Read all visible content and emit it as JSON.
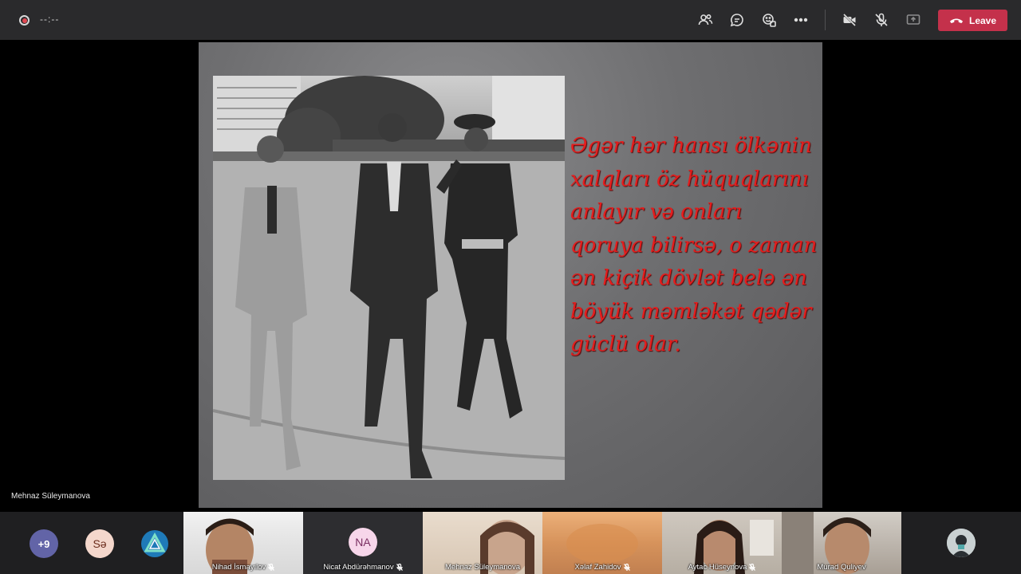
{
  "meeting": {
    "timer": "--:--",
    "leave_label": "Leave"
  },
  "toolbar": {
    "icons": [
      "participants-icon",
      "chat-icon",
      "reactions-icon",
      "more-icon",
      "camera-off-icon",
      "mic-off-icon",
      "share-tray-icon"
    ]
  },
  "slide": {
    "quote_lines": [
      "Əgər hər hansı ölkənin",
      "xalqları öz hüquqlarını",
      "anlayır və onları",
      "qoruya bilirsə, o zaman",
      "ən kiçik dövlət belə ən",
      "böyük məmləkət qədər",
      "güclü olar."
    ],
    "quote_color": "#e51d1d"
  },
  "presenter": {
    "name": "Mehnaz Süleymanova"
  },
  "participants": {
    "overflow_count": "+9",
    "se_initials": "Sə",
    "tiles": [
      {
        "name": "Nihad İsmayılov"
      },
      {
        "name": "Nicat Abdürəhmanov",
        "initials": "NA"
      },
      {
        "name": "Mehnaz Süleymanova"
      },
      {
        "name": "Xəlaf Zahidov"
      },
      {
        "name": "Aytac Hüseynova"
      },
      {
        "name": "Murad Quliyev"
      }
    ]
  },
  "colors": {
    "topbar": "#2a2a2c",
    "leave": "#c4314b",
    "overflow_bubble": "#6264a7"
  }
}
